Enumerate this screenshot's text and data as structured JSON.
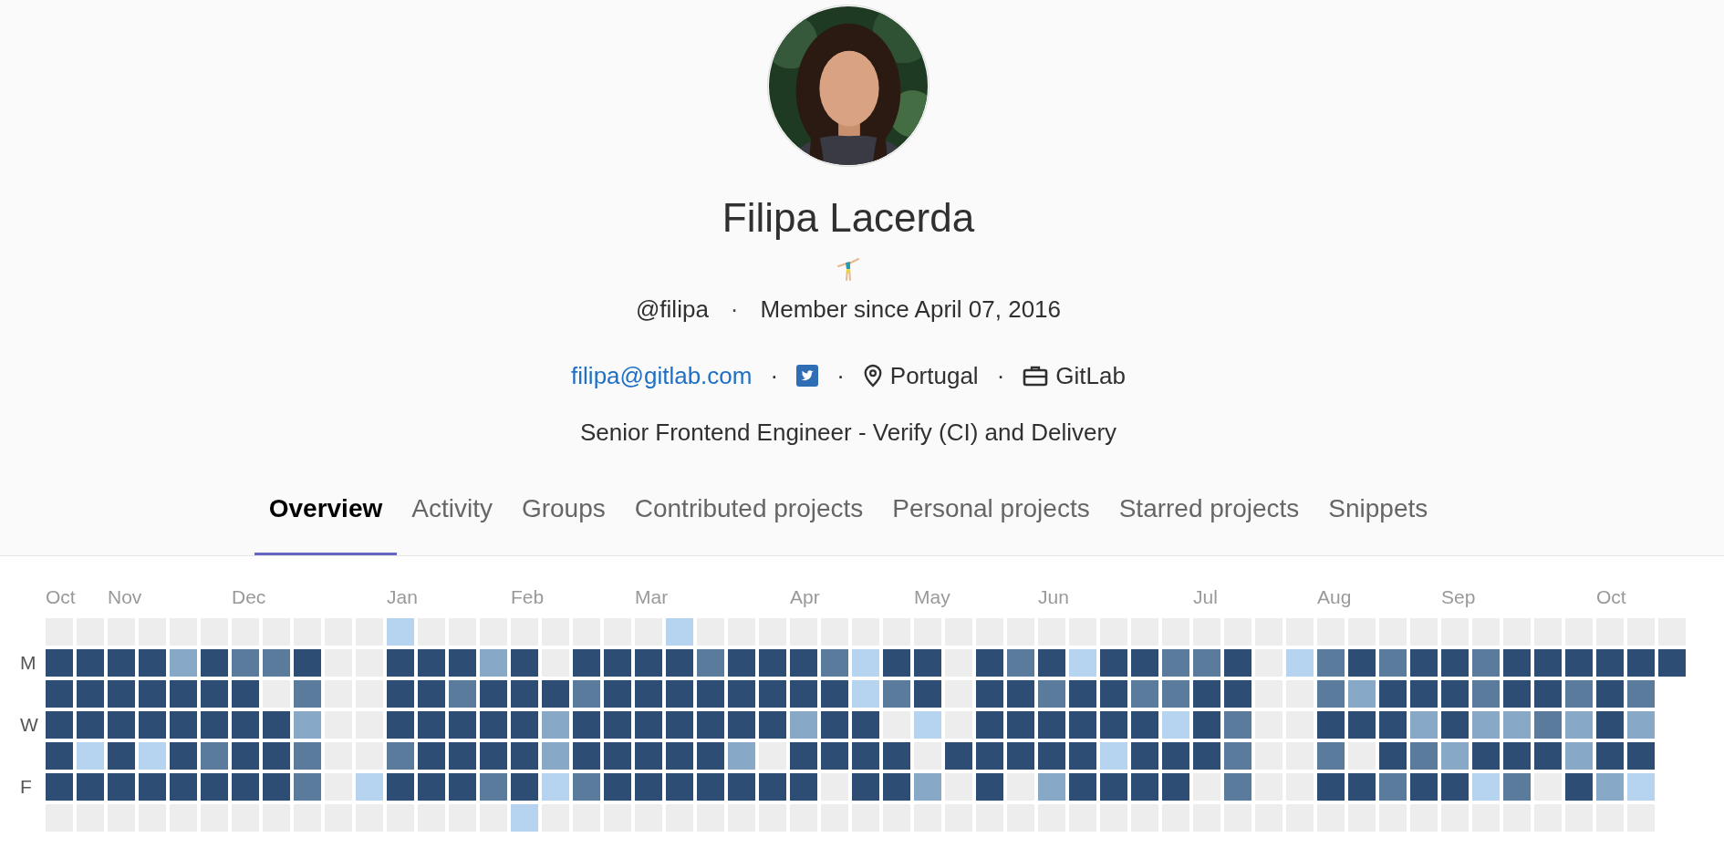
{
  "profile": {
    "name": "Filipa Lacerda",
    "meta": [
      {
        "kind": "text",
        "text": "@filipa"
      },
      {
        "kind": "separator",
        "text": "·"
      },
      {
        "kind": "text",
        "text": "Member since April 07, 2016"
      }
    ],
    "details": [
      {
        "kind": "link",
        "text": "filipa@gitlab.com"
      },
      {
        "kind": "separator",
        "text": "·"
      },
      {
        "kind": "social"
      },
      {
        "kind": "separator",
        "text": "·"
      },
      {
        "kind": "location",
        "text": "Portugal"
      },
      {
        "kind": "separator",
        "text": "·"
      },
      {
        "kind": "organization",
        "text": "GitLab"
      }
    ],
    "bio": "Senior Frontend Engineer - Verify (CI) and Delivery"
  },
  "tabs": [
    {
      "label": "Overview",
      "selected": true
    },
    {
      "label": "Activity",
      "selected": false
    },
    {
      "label": "Groups",
      "selected": false
    },
    {
      "label": "Contributed projects",
      "selected": false
    },
    {
      "label": "Personal projects",
      "selected": false
    },
    {
      "label": "Starred projects",
      "selected": false
    },
    {
      "label": "Snippets",
      "selected": false
    }
  ],
  "calendar": {
    "day_labels": [
      "M",
      "W",
      "F"
    ],
    "weeks": [
      {
        "month": "Oct",
        "days": [
          {
            "color": "#ededed"
          },
          {
            "color": "#2e4d74"
          },
          {
            "color": "#2e4d74"
          },
          {
            "color": "#2e4d74"
          },
          {
            "color": "#2e4d74"
          },
          {
            "color": "#2e4d74"
          },
          {
            "color": "#ededed"
          }
        ]
      },
      {
        "days": [
          {
            "color": "#ededed"
          },
          {
            "color": "#2e4d74"
          },
          {
            "color": "#2e4d74"
          },
          {
            "color": "#2e4d74"
          },
          {
            "color": "#b6d4f0"
          },
          {
            "color": "#2e4d74"
          },
          {
            "color": "#ededed"
          }
        ]
      },
      {
        "month": "Nov",
        "days": [
          {
            "color": "#ededed"
          },
          {
            "color": "#2e4d74"
          },
          {
            "color": "#2e4d74"
          },
          {
            "color": "#2e4d74"
          },
          {
            "color": "#2e4d74"
          },
          {
            "color": "#2e4d74"
          },
          {
            "color": "#ededed"
          }
        ]
      },
      {
        "days": [
          {
            "color": "#ededed"
          },
          {
            "color": "#2e4d74"
          },
          {
            "color": "#2e4d74"
          },
          {
            "color": "#2e4d74"
          },
          {
            "color": "#b6d4f0"
          },
          {
            "color": "#2e4d74"
          },
          {
            "color": "#ededed"
          }
        ]
      },
      {
        "days": [
          {
            "color": "#ededed"
          },
          {
            "color": "#88a8c8"
          },
          {
            "color": "#2e4d74"
          },
          {
            "color": "#2e4d74"
          },
          {
            "color": "#2e4d74"
          },
          {
            "color": "#2e4d74"
          },
          {
            "color": "#ededed"
          }
        ]
      },
      {
        "days": [
          {
            "color": "#ededed"
          },
          {
            "color": "#2e4d74"
          },
          {
            "color": "#2e4d74"
          },
          {
            "color": "#2e4d74"
          },
          {
            "color": "#5b7b9d"
          },
          {
            "color": "#2e4d74"
          },
          {
            "color": "#ededed"
          }
        ]
      },
      {
        "month": "Dec",
        "days": [
          {
            "color": "#ededed"
          },
          {
            "color": "#5b7b9d"
          },
          {
            "color": "#2e4d74"
          },
          {
            "color": "#2e4d74"
          },
          {
            "color": "#2e4d74"
          },
          {
            "color": "#2e4d74"
          },
          {
            "color": "#ededed"
          }
        ]
      },
      {
        "days": [
          {
            "color": "#ededed"
          },
          {
            "color": "#5b7b9d"
          },
          {
            "color": "#ededed"
          },
          {
            "color": "#2e4d74"
          },
          {
            "color": "#2e4d74"
          },
          {
            "color": "#2e4d74"
          },
          {
            "color": "#ededed"
          }
        ]
      },
      {
        "days": [
          {
            "color": "#ededed"
          },
          {
            "color": "#2e4d74"
          },
          {
            "color": "#5b7b9d"
          },
          {
            "color": "#88a8c8"
          },
          {
            "color": "#5b7b9d"
          },
          {
            "color": "#5b7b9d"
          },
          {
            "color": "#ededed"
          }
        ]
      },
      {
        "days": [
          {
            "color": "#ededed"
          },
          {
            "color": "#ededed"
          },
          {
            "color": "#ededed"
          },
          {
            "color": "#ededed"
          },
          {
            "color": "#ededed"
          },
          {
            "color": "#ededed"
          },
          {
            "color": "#ededed"
          }
        ]
      },
      {
        "days": [
          {
            "color": "#ededed"
          },
          {
            "color": "#ededed"
          },
          {
            "color": "#ededed"
          },
          {
            "color": "#ededed"
          },
          {
            "color": "#ededed"
          },
          {
            "color": "#b6d4f0"
          },
          {
            "color": "#ededed"
          }
        ]
      },
      {
        "month": "Jan",
        "days": [
          {
            "color": "#b6d4f0"
          },
          {
            "color": "#2e4d74"
          },
          {
            "color": "#2e4d74"
          },
          {
            "color": "#2e4d74"
          },
          {
            "color": "#5b7b9d"
          },
          {
            "color": "#2e4d74"
          },
          {
            "color": "#ededed"
          }
        ]
      },
      {
        "days": [
          {
            "color": "#ededed"
          },
          {
            "color": "#2e4d74"
          },
          {
            "color": "#2e4d74"
          },
          {
            "color": "#2e4d74"
          },
          {
            "color": "#2e4d74"
          },
          {
            "color": "#2e4d74"
          },
          {
            "color": "#ededed"
          }
        ]
      },
      {
        "days": [
          {
            "color": "#ededed"
          },
          {
            "color": "#2e4d74"
          },
          {
            "color": "#5b7b9d"
          },
          {
            "color": "#2e4d74"
          },
          {
            "color": "#2e4d74"
          },
          {
            "color": "#2e4d74"
          },
          {
            "color": "#ededed"
          }
        ]
      },
      {
        "days": [
          {
            "color": "#ededed"
          },
          {
            "color": "#88a8c8"
          },
          {
            "color": "#2e4d74"
          },
          {
            "color": "#2e4d74"
          },
          {
            "color": "#2e4d74"
          },
          {
            "color": "#5b7b9d"
          },
          {
            "color": "#ededed"
          }
        ]
      },
      {
        "month": "Feb",
        "days": [
          {
            "color": "#ededed"
          },
          {
            "color": "#2e4d74"
          },
          {
            "color": "#2e4d74"
          },
          {
            "color": "#2e4d74"
          },
          {
            "color": "#2e4d74"
          },
          {
            "color": "#2e4d74"
          },
          {
            "color": "#b6d4f0"
          }
        ]
      },
      {
        "days": [
          {
            "color": "#ededed"
          },
          {
            "color": "#ededed"
          },
          {
            "color": "#2e4d74"
          },
          {
            "color": "#88a8c8"
          },
          {
            "color": "#88a8c8"
          },
          {
            "color": "#b6d4f0"
          },
          {
            "color": "#ededed"
          }
        ]
      },
      {
        "days": [
          {
            "color": "#ededed"
          },
          {
            "color": "#2e4d74"
          },
          {
            "color": "#5b7b9d"
          },
          {
            "color": "#2e4d74"
          },
          {
            "color": "#2e4d74"
          },
          {
            "color": "#5b7b9d"
          },
          {
            "color": "#ededed"
          }
        ]
      },
      {
        "days": [
          {
            "color": "#ededed"
          },
          {
            "color": "#2e4d74"
          },
          {
            "color": "#2e4d74"
          },
          {
            "color": "#2e4d74"
          },
          {
            "color": "#2e4d74"
          },
          {
            "color": "#2e4d74"
          },
          {
            "color": "#ededed"
          }
        ]
      },
      {
        "month": "Mar",
        "days": [
          {
            "color": "#ededed"
          },
          {
            "color": "#2e4d74"
          },
          {
            "color": "#2e4d74"
          },
          {
            "color": "#2e4d74"
          },
          {
            "color": "#2e4d74"
          },
          {
            "color": "#2e4d74"
          },
          {
            "color": "#ededed"
          }
        ]
      },
      {
        "days": [
          {
            "color": "#b6d4f0"
          },
          {
            "color": "#2e4d74"
          },
          {
            "color": "#2e4d74"
          },
          {
            "color": "#2e4d74"
          },
          {
            "color": "#2e4d74"
          },
          {
            "color": "#2e4d74"
          },
          {
            "color": "#ededed"
          }
        ]
      },
      {
        "days": [
          {
            "color": "#ededed"
          },
          {
            "color": "#5b7b9d"
          },
          {
            "color": "#2e4d74"
          },
          {
            "color": "#2e4d74"
          },
          {
            "color": "#2e4d74"
          },
          {
            "color": "#2e4d74"
          },
          {
            "color": "#ededed"
          }
        ]
      },
      {
        "days": [
          {
            "color": "#ededed"
          },
          {
            "color": "#2e4d74"
          },
          {
            "color": "#2e4d74"
          },
          {
            "color": "#2e4d74"
          },
          {
            "color": "#88a8c8"
          },
          {
            "color": "#2e4d74"
          },
          {
            "color": "#ededed"
          }
        ]
      },
      {
        "days": [
          {
            "color": "#ededed"
          },
          {
            "color": "#2e4d74"
          },
          {
            "color": "#2e4d74"
          },
          {
            "color": "#2e4d74"
          },
          {
            "color": "#ededed"
          },
          {
            "color": "#2e4d74"
          },
          {
            "color": "#ededed"
          }
        ]
      },
      {
        "month": "Apr",
        "days": [
          {
            "color": "#ededed"
          },
          {
            "color": "#2e4d74"
          },
          {
            "color": "#2e4d74"
          },
          {
            "color": "#88a8c8"
          },
          {
            "color": "#2e4d74"
          },
          {
            "color": "#2e4d74"
          },
          {
            "color": "#ededed"
          }
        ]
      },
      {
        "days": [
          {
            "color": "#ededed"
          },
          {
            "color": "#5b7b9d"
          },
          {
            "color": "#2e4d74"
          },
          {
            "color": "#2e4d74"
          },
          {
            "color": "#2e4d74"
          },
          {
            "color": "#ededed"
          },
          {
            "color": "#ededed"
          }
        ]
      },
      {
        "days": [
          {
            "color": "#ededed"
          },
          {
            "color": "#b6d4f0"
          },
          {
            "color": "#b6d4f0"
          },
          {
            "color": "#2e4d74"
          },
          {
            "color": "#2e4d74"
          },
          {
            "color": "#2e4d74"
          },
          {
            "color": "#ededed"
          }
        ]
      },
      {
        "days": [
          {
            "color": "#ededed"
          },
          {
            "color": "#2e4d74"
          },
          {
            "color": "#5b7b9d"
          },
          {
            "color": "#ededed"
          },
          {
            "color": "#2e4d74"
          },
          {
            "color": "#2e4d74"
          },
          {
            "color": "#ededed"
          }
        ]
      },
      {
        "month": "May",
        "days": [
          {
            "color": "#ededed"
          },
          {
            "color": "#2e4d74"
          },
          {
            "color": "#2e4d74"
          },
          {
            "color": "#b6d4f0"
          },
          {
            "color": "#ededed"
          },
          {
            "color": "#88a8c8"
          },
          {
            "color": "#ededed"
          }
        ]
      },
      {
        "days": [
          {
            "color": "#ededed"
          },
          {
            "color": "#ededed"
          },
          {
            "color": "#ededed"
          },
          {
            "color": "#ededed"
          },
          {
            "color": "#2e4d74"
          },
          {
            "color": "#ededed"
          },
          {
            "color": "#ededed"
          }
        ]
      },
      {
        "days": [
          {
            "color": "#ededed"
          },
          {
            "color": "#2e4d74"
          },
          {
            "color": "#2e4d74"
          },
          {
            "color": "#2e4d74"
          },
          {
            "color": "#2e4d74"
          },
          {
            "color": "#2e4d74"
          },
          {
            "color": "#ededed"
          }
        ]
      },
      {
        "days": [
          {
            "color": "#ededed"
          },
          {
            "color": "#5b7b9d"
          },
          {
            "color": "#2e4d74"
          },
          {
            "color": "#2e4d74"
          },
          {
            "color": "#2e4d74"
          },
          {
            "color": "#ededed"
          },
          {
            "color": "#ededed"
          }
        ]
      },
      {
        "month": "Jun",
        "days": [
          {
            "color": "#ededed"
          },
          {
            "color": "#2e4d74"
          },
          {
            "color": "#5b7b9d"
          },
          {
            "color": "#2e4d74"
          },
          {
            "color": "#2e4d74"
          },
          {
            "color": "#88a8c8"
          },
          {
            "color": "#ededed"
          }
        ]
      },
      {
        "days": [
          {
            "color": "#ededed"
          },
          {
            "color": "#b6d4f0"
          },
          {
            "color": "#2e4d74"
          },
          {
            "color": "#2e4d74"
          },
          {
            "color": "#2e4d74"
          },
          {
            "color": "#2e4d74"
          },
          {
            "color": "#ededed"
          }
        ]
      },
      {
        "days": [
          {
            "color": "#ededed"
          },
          {
            "color": "#2e4d74"
          },
          {
            "color": "#2e4d74"
          },
          {
            "color": "#2e4d74"
          },
          {
            "color": "#b6d4f0"
          },
          {
            "color": "#2e4d74"
          },
          {
            "color": "#ededed"
          }
        ]
      },
      {
        "days": [
          {
            "color": "#ededed"
          },
          {
            "color": "#2e4d74"
          },
          {
            "color": "#5b7b9d"
          },
          {
            "color": "#2e4d74"
          },
          {
            "color": "#2e4d74"
          },
          {
            "color": "#2e4d74"
          },
          {
            "color": "#ededed"
          }
        ]
      },
      {
        "days": [
          {
            "color": "#ededed"
          },
          {
            "color": "#5b7b9d"
          },
          {
            "color": "#5b7b9d"
          },
          {
            "color": "#b6d4f0"
          },
          {
            "color": "#2e4d74"
          },
          {
            "color": "#2e4d74"
          },
          {
            "color": "#ededed"
          }
        ]
      },
      {
        "month": "Jul",
        "days": [
          {
            "color": "#ededed"
          },
          {
            "color": "#5b7b9d"
          },
          {
            "color": "#2e4d74"
          },
          {
            "color": "#2e4d74"
          },
          {
            "color": "#2e4d74"
          },
          {
            "color": "#ededed"
          },
          {
            "color": "#ededed"
          }
        ]
      },
      {
        "days": [
          {
            "color": "#ededed"
          },
          {
            "color": "#2e4d74"
          },
          {
            "color": "#2e4d74"
          },
          {
            "color": "#5b7b9d"
          },
          {
            "color": "#5b7b9d"
          },
          {
            "color": "#5b7b9d"
          },
          {
            "color": "#ededed"
          }
        ]
      },
      {
        "days": [
          {
            "color": "#ededed"
          },
          {
            "color": "#ededed"
          },
          {
            "color": "#ededed"
          },
          {
            "color": "#ededed"
          },
          {
            "color": "#ededed"
          },
          {
            "color": "#ededed"
          },
          {
            "color": "#ededed"
          }
        ]
      },
      {
        "days": [
          {
            "color": "#ededed"
          },
          {
            "color": "#b6d4f0"
          },
          {
            "color": "#ededed"
          },
          {
            "color": "#ededed"
          },
          {
            "color": "#ededed"
          },
          {
            "color": "#ededed"
          },
          {
            "color": "#ededed"
          }
        ]
      },
      {
        "month": "Aug",
        "days": [
          {
            "color": "#ededed"
          },
          {
            "color": "#5b7b9d"
          },
          {
            "color": "#5b7b9d"
          },
          {
            "color": "#2e4d74"
          },
          {
            "color": "#5b7b9d"
          },
          {
            "color": "#2e4d74"
          },
          {
            "color": "#ededed"
          }
        ]
      },
      {
        "days": [
          {
            "color": "#ededed"
          },
          {
            "color": "#2e4d74"
          },
          {
            "color": "#88a8c8"
          },
          {
            "color": "#2e4d74"
          },
          {
            "color": "#ededed"
          },
          {
            "color": "#2e4d74"
          },
          {
            "color": "#ededed"
          }
        ]
      },
      {
        "days": [
          {
            "color": "#ededed"
          },
          {
            "color": "#5b7b9d"
          },
          {
            "color": "#2e4d74"
          },
          {
            "color": "#2e4d74"
          },
          {
            "color": "#2e4d74"
          },
          {
            "color": "#5b7b9d"
          },
          {
            "color": "#ededed"
          }
        ]
      },
      {
        "days": [
          {
            "color": "#ededed"
          },
          {
            "color": "#2e4d74"
          },
          {
            "color": "#2e4d74"
          },
          {
            "color": "#88a8c8"
          },
          {
            "color": "#5b7b9d"
          },
          {
            "color": "#2e4d74"
          },
          {
            "color": "#ededed"
          }
        ]
      },
      {
        "month": "Sep",
        "days": [
          {
            "color": "#ededed"
          },
          {
            "color": "#2e4d74"
          },
          {
            "color": "#2e4d74"
          },
          {
            "color": "#2e4d74"
          },
          {
            "color": "#88a8c8"
          },
          {
            "color": "#2e4d74"
          },
          {
            "color": "#ededed"
          }
        ]
      },
      {
        "days": [
          {
            "color": "#ededed"
          },
          {
            "color": "#5b7b9d"
          },
          {
            "color": "#5b7b9d"
          },
          {
            "color": "#88a8c8"
          },
          {
            "color": "#2e4d74"
          },
          {
            "color": "#b6d4f0"
          },
          {
            "color": "#ededed"
          }
        ]
      },
      {
        "days": [
          {
            "color": "#ededed"
          },
          {
            "color": "#2e4d74"
          },
          {
            "color": "#2e4d74"
          },
          {
            "color": "#88a8c8"
          },
          {
            "color": "#2e4d74"
          },
          {
            "color": "#5b7b9d"
          },
          {
            "color": "#ededed"
          }
        ]
      },
      {
        "days": [
          {
            "color": "#ededed"
          },
          {
            "color": "#2e4d74"
          },
          {
            "color": "#2e4d74"
          },
          {
            "color": "#5b7b9d"
          },
          {
            "color": "#2e4d74"
          },
          {
            "color": "#ededed"
          },
          {
            "color": "#ededed"
          }
        ]
      },
      {
        "days": [
          {
            "color": "#ededed"
          },
          {
            "color": "#2e4d74"
          },
          {
            "color": "#5b7b9d"
          },
          {
            "color": "#88a8c8"
          },
          {
            "color": "#88a8c8"
          },
          {
            "color": "#2e4d74"
          },
          {
            "color": "#ededed"
          }
        ]
      },
      {
        "month": "Oct",
        "days": [
          {
            "color": "#ededed"
          },
          {
            "color": "#2e4d74"
          },
          {
            "color": "#2e4d74"
          },
          {
            "color": "#2e4d74"
          },
          {
            "color": "#2e4d74"
          },
          {
            "color": "#88a8c8"
          },
          {
            "color": "#ededed"
          }
        ]
      },
      {
        "days": [
          {
            "color": "#ededed"
          },
          {
            "color": "#2e4d74"
          },
          {
            "color": "#5b7b9d"
          },
          {
            "color": "#88a8c8"
          },
          {
            "color": "#2e4d74"
          },
          {
            "color": "#b6d4f0"
          },
          {
            "color": "#ededed"
          }
        ]
      },
      {
        "days": [
          {
            "color": "#ededed"
          },
          {
            "color": "#2e4d74"
          }
        ]
      }
    ]
  }
}
